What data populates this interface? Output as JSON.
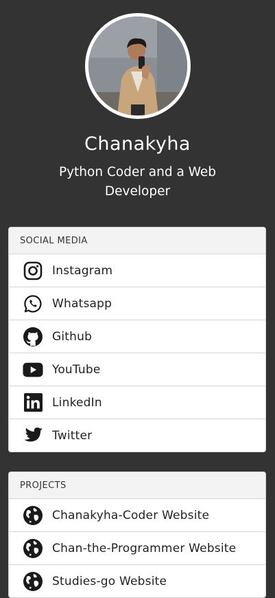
{
  "profile": {
    "name": "Chanakyha",
    "tagline": "Python Coder and a Web Developer",
    "avatar_icon": "profile-photo"
  },
  "social": {
    "header": "SOCIAL MEDIA",
    "items": [
      {
        "label": "Instagram",
        "icon": "instagram-icon"
      },
      {
        "label": "Whatsapp",
        "icon": "whatsapp-icon"
      },
      {
        "label": "Github",
        "icon": "github-icon"
      },
      {
        "label": "YouTube",
        "icon": "youtube-icon"
      },
      {
        "label": "LinkedIn",
        "icon": "linkedin-icon"
      },
      {
        "label": "Twitter",
        "icon": "twitter-icon"
      }
    ]
  },
  "projects": {
    "header": "PROJECTS",
    "items": [
      {
        "label": "Chanakyha-Coder Website",
        "icon": "globe-icon"
      },
      {
        "label": "Chan-the-Programmer Website",
        "icon": "globe-icon"
      },
      {
        "label": "Studies-go Website",
        "icon": "globe-icon"
      }
    ]
  },
  "colors": {
    "background": "#333333",
    "card": "#ffffff",
    "header": "#f3f3f3",
    "icon": "#1a1a1a"
  }
}
